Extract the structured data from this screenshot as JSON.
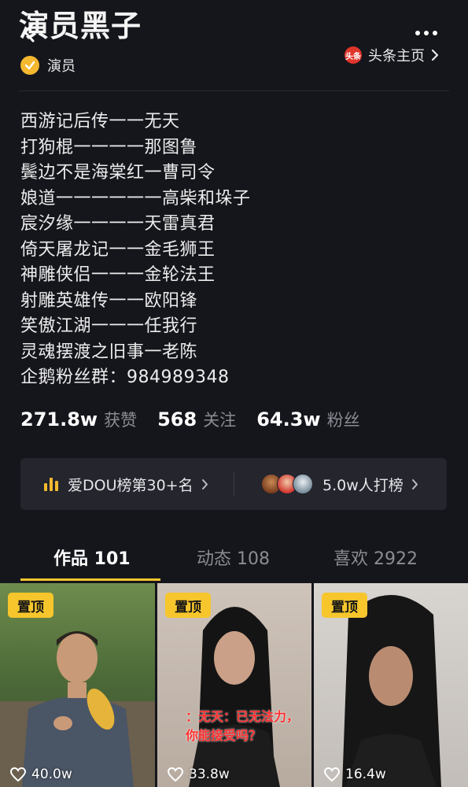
{
  "header": {
    "profile_name": "演员黑子",
    "verified_label": "演员",
    "toutiao_logo_text": "头条",
    "toutiao_label": "头条主页"
  },
  "bio_lines": [
    "西游记后传一一无天",
    "打狗棍一一一一那图鲁",
    "鬓边不是海棠红一曹司令",
    "娘道一一一一一一高柴和垛子",
    "宸汐缘一一一一天雷真君",
    "倚天屠龙记一一金毛狮王",
    "神雕侠侣一一一金轮法王",
    "射雕英雄传一一欧阳锋",
    "笑傲江湖一一一任我行",
    "灵魂摆渡之旧事一老陈",
    "企鹅粉丝群：984989348"
  ],
  "stats": {
    "likes_value": "271.8w",
    "likes_label": "获赞",
    "following_value": "568",
    "following_label": "关注",
    "fans_value": "64.3w",
    "fans_label": "粉丝"
  },
  "rank_card": {
    "rank_label": "爱DOU榜第30+名",
    "fans_label": "5.0w人打榜"
  },
  "tabs": [
    {
      "label": "作品 101",
      "active": true
    },
    {
      "label": "动态 108",
      "active": false
    },
    {
      "label": "喜欢 2922",
      "active": false
    }
  ],
  "videos": [
    {
      "pin_label": "置顶",
      "likes": "40.0w",
      "caption_line1": "",
      "caption_line2": ""
    },
    {
      "pin_label": "置顶",
      "likes": "33.8w",
      "caption_line1": "：无天：已无法力，",
      "caption_line2": "你能接受吗？"
    },
    {
      "pin_label": "置顶",
      "likes": "16.4w",
      "caption_line1": "",
      "caption_line2": ""
    }
  ],
  "colors": {
    "background": "#15161c",
    "accent": "#f6c62c",
    "verified": "#f5b82e",
    "toutiao_red": "#e0352b",
    "muted_text": "#8b8c93"
  },
  "icons": [
    "back-icon",
    "more-icon",
    "verified-check-icon",
    "toutiao-logo",
    "chevron-right-icon",
    "bars-icon",
    "heart-icon"
  ]
}
